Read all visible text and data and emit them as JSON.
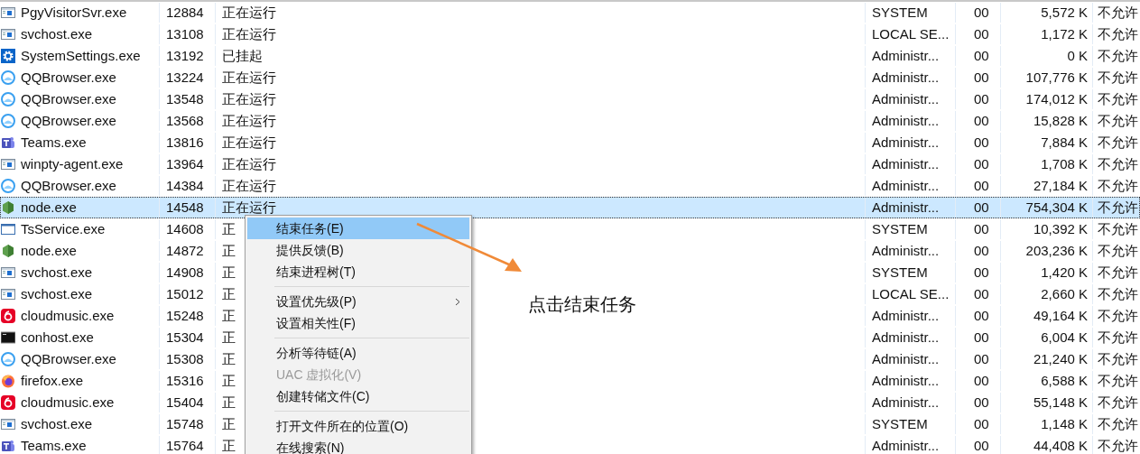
{
  "rows": [
    {
      "kind": "app",
      "name": "PgyVisitorSvr.exe",
      "pid": "12884",
      "status": "正在运行",
      "user": "SYSTEM",
      "cpu": "00",
      "memory": "5,572 K",
      "column_7": "不允许",
      "selected": false
    },
    {
      "kind": "app",
      "name": "svchost.exe",
      "pid": "13108",
      "status": "正在运行",
      "user": "LOCAL SE...",
      "cpu": "00",
      "memory": "1,172 K",
      "column_7": "不允许",
      "selected": false
    },
    {
      "kind": "gear",
      "name": "SystemSettings.exe",
      "pid": "13192",
      "status": "已挂起",
      "user": "Administr...",
      "cpu": "00",
      "memory": "0 K",
      "column_7": "不允许",
      "selected": false
    },
    {
      "kind": "browser",
      "name": "QQBrowser.exe",
      "pid": "13224",
      "status": "正在运行",
      "user": "Administr...",
      "cpu": "00",
      "memory": "107,776 K",
      "column_7": "不允许",
      "selected": false
    },
    {
      "kind": "browser",
      "name": "QQBrowser.exe",
      "pid": "13548",
      "status": "正在运行",
      "user": "Administr...",
      "cpu": "00",
      "memory": "174,012 K",
      "column_7": "不允许",
      "selected": false
    },
    {
      "kind": "browser",
      "name": "QQBrowser.exe",
      "pid": "13568",
      "status": "正在运行",
      "user": "Administr...",
      "cpu": "00",
      "memory": "15,828 K",
      "column_7": "不允许",
      "selected": false
    },
    {
      "kind": "teams",
      "name": "Teams.exe",
      "pid": "13816",
      "status": "正在运行",
      "user": "Administr...",
      "cpu": "00",
      "memory": "7,884 K",
      "column_7": "不允许",
      "selected": false
    },
    {
      "kind": "app",
      "name": "winpty-agent.exe",
      "pid": "13964",
      "status": "正在运行",
      "user": "Administr...",
      "cpu": "00",
      "memory": "1,708 K",
      "column_7": "不允许",
      "selected": false
    },
    {
      "kind": "browser",
      "name": "QQBrowser.exe",
      "pid": "14384",
      "status": "正在运行",
      "user": "Administr...",
      "cpu": "00",
      "memory": "27,184 K",
      "column_7": "不允许",
      "selected": false
    },
    {
      "kind": "hexagon",
      "name": "node.exe",
      "pid": "14548",
      "status": "正在运行",
      "user": "Administr...",
      "cpu": "00",
      "memory": "754,304 K",
      "column_7": "不允许",
      "selected": true
    },
    {
      "kind": "window",
      "name": "TsService.exe",
      "pid": "14608",
      "status": "正",
      "user": "SYSTEM",
      "cpu": "00",
      "memory": "10,392 K",
      "column_7": "不允许",
      "selected": false
    },
    {
      "kind": "hexagon",
      "name": "node.exe",
      "pid": "14872",
      "status": "正",
      "user": "Administr...",
      "cpu": "00",
      "memory": "203,236 K",
      "column_7": "不允许",
      "selected": false
    },
    {
      "kind": "app",
      "name": "svchost.exe",
      "pid": "14908",
      "status": "正",
      "user": "SYSTEM",
      "cpu": "00",
      "memory": "1,420 K",
      "column_7": "不允许",
      "selected": false
    },
    {
      "kind": "app",
      "name": "svchost.exe",
      "pid": "15012",
      "status": "正",
      "user": "LOCAL SE...",
      "cpu": "00",
      "memory": "2,660 K",
      "column_7": "不允许",
      "selected": false
    },
    {
      "kind": "music",
      "name": "cloudmusic.exe",
      "pid": "15248",
      "status": "正",
      "user": "Administr...",
      "cpu": "00",
      "memory": "49,164 K",
      "column_7": "不允许",
      "selected": false
    },
    {
      "kind": "console",
      "name": "conhost.exe",
      "pid": "15304",
      "status": "正",
      "user": "Administr...",
      "cpu": "00",
      "memory": "6,004 K",
      "column_7": "不允许",
      "selected": false
    },
    {
      "kind": "browser",
      "name": "QQBrowser.exe",
      "pid": "15308",
      "status": "正",
      "user": "Administr...",
      "cpu": "00",
      "memory": "21,240 K",
      "column_7": "不允许",
      "selected": false
    },
    {
      "kind": "fox",
      "name": "firefox.exe",
      "pid": "15316",
      "status": "正",
      "user": "Administr...",
      "cpu": "00",
      "memory": "6,588 K",
      "column_7": "不允许",
      "selected": false
    },
    {
      "kind": "music",
      "name": "cloudmusic.exe",
      "pid": "15404",
      "status": "正",
      "user": "Administr...",
      "cpu": "00",
      "memory": "55,148 K",
      "column_7": "不允许",
      "selected": false
    },
    {
      "kind": "app",
      "name": "svchost.exe",
      "pid": "15748",
      "status": "正",
      "user": "SYSTEM",
      "cpu": "00",
      "memory": "1,148 K",
      "column_7": "不允许",
      "selected": false
    },
    {
      "kind": "teams",
      "name": "Teams.exe",
      "pid": "15764",
      "status": "正",
      "user": "Administr...",
      "cpu": "00",
      "memory": "44,408 K",
      "column_7": "不允许",
      "selected": false
    }
  ],
  "context_menu": {
    "items": [
      {
        "kind": "item",
        "label": "结束任务(E)",
        "selected": true,
        "disabled": false,
        "submenu": false
      },
      {
        "kind": "item",
        "label": "提供反馈(B)",
        "selected": false,
        "disabled": false,
        "submenu": false
      },
      {
        "kind": "item",
        "label": "结束进程树(T)",
        "selected": false,
        "disabled": false,
        "submenu": false
      },
      {
        "kind": "separator"
      },
      {
        "kind": "item",
        "label": "设置优先级(P)",
        "selected": false,
        "disabled": false,
        "submenu": true
      },
      {
        "kind": "item",
        "label": "设置相关性(F)",
        "selected": false,
        "disabled": false,
        "submenu": false
      },
      {
        "kind": "separator"
      },
      {
        "kind": "item",
        "label": "分析等待链(A)",
        "selected": false,
        "disabled": false,
        "submenu": false
      },
      {
        "kind": "item",
        "label": "UAC 虚拟化(V)",
        "selected": false,
        "disabled": true,
        "submenu": false
      },
      {
        "kind": "item",
        "label": "创建转储文件(C)",
        "selected": false,
        "disabled": false,
        "submenu": false
      },
      {
        "kind": "separator"
      },
      {
        "kind": "item",
        "label": "打开文件所在的位置(O)",
        "selected": false,
        "disabled": false,
        "submenu": false
      },
      {
        "kind": "item",
        "label": "在线搜索(N)",
        "selected": false,
        "disabled": false,
        "submenu": false
      }
    ]
  },
  "annotation": {
    "text": "点击结束任务"
  }
}
